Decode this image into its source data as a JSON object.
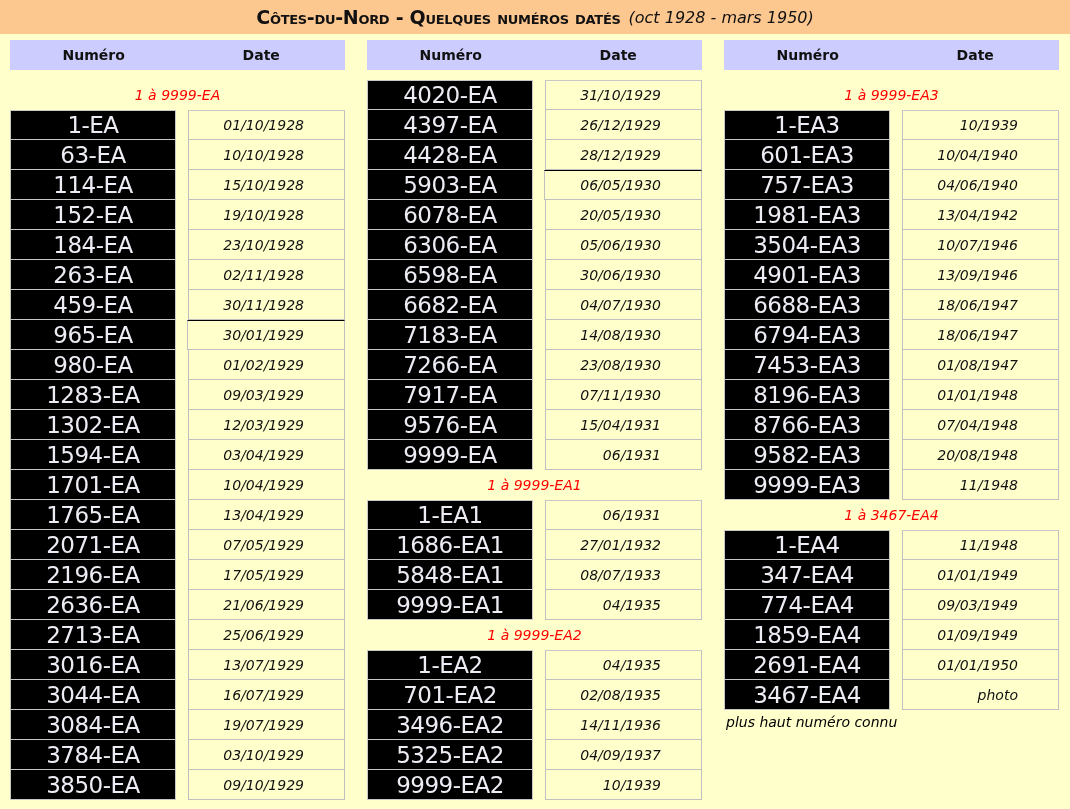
{
  "title": "Côtes-du-Nord - Quelques numéros datés",
  "subtitle": "(oct 1928 - mars 1950)",
  "columns": [
    {
      "headers": [
        "Numéro",
        "Date"
      ],
      "groups": [
        {
          "range_label": "1 à 9999-EA",
          "rows": [
            {
              "number": "1-EA",
              "date": "01/10/1928",
              "separator_above": false
            },
            {
              "number": "63-EA",
              "date": "10/10/1928",
              "separator_above": false
            },
            {
              "number": "114-EA",
              "date": "15/10/1928",
              "separator_above": false
            },
            {
              "number": "152-EA",
              "date": "19/10/1928",
              "separator_above": false
            },
            {
              "number": "184-EA",
              "date": "23/10/1928",
              "separator_above": false
            },
            {
              "number": "263-EA",
              "date": "02/11/1928",
              "separator_above": false
            },
            {
              "number": "459-EA",
              "date": "30/11/1928",
              "separator_above": false
            },
            {
              "number": "965-EA",
              "date": "30/01/1929",
              "separator_above": true
            },
            {
              "number": "980-EA",
              "date": "01/02/1929",
              "separator_above": false
            },
            {
              "number": "1283-EA",
              "date": "09/03/1929",
              "separator_above": false
            },
            {
              "number": "1302-EA",
              "date": "12/03/1929",
              "separator_above": false
            },
            {
              "number": "1594-EA",
              "date": "03/04/1929",
              "separator_above": false
            },
            {
              "number": "1701-EA",
              "date": "10/04/1929",
              "separator_above": false
            },
            {
              "number": "1765-EA",
              "date": "13/04/1929",
              "separator_above": false
            },
            {
              "number": "2071-EA",
              "date": "07/05/1929",
              "separator_above": false
            },
            {
              "number": "2196-EA",
              "date": "17/05/1929",
              "separator_above": false
            },
            {
              "number": "2636-EA",
              "date": "21/06/1929",
              "separator_above": false
            },
            {
              "number": "2713-EA",
              "date": "25/06/1929",
              "separator_above": false
            },
            {
              "number": "3016-EA",
              "date": "13/07/1929",
              "separator_above": false
            },
            {
              "number": "3044-EA",
              "date": "16/07/1929",
              "separator_above": false
            },
            {
              "number": "3084-EA",
              "date": "19/07/1929",
              "separator_above": false
            },
            {
              "number": "3784-EA",
              "date": "03/10/1929",
              "separator_above": false
            },
            {
              "number": "3850-EA",
              "date": "09/10/1929",
              "separator_above": false
            }
          ]
        }
      ]
    },
    {
      "headers": [
        "Numéro",
        "Date"
      ],
      "groups": [
        {
          "rows": [
            {
              "number": "4020-EA",
              "date": "31/10/1929",
              "separator_above": false
            },
            {
              "number": "4397-EA",
              "date": "26/12/1929",
              "separator_above": false
            },
            {
              "number": "4428-EA",
              "date": "28/12/1929",
              "separator_above": false
            },
            {
              "number": "5903-EA",
              "date": "06/05/1930",
              "separator_above": true
            },
            {
              "number": "6078-EA",
              "date": "20/05/1930",
              "separator_above": false
            },
            {
              "number": "6306-EA",
              "date": "05/06/1930",
              "separator_above": false
            },
            {
              "number": "6598-EA",
              "date": "30/06/1930",
              "separator_above": false
            },
            {
              "number": "6682-EA",
              "date": "04/07/1930",
              "separator_above": false
            },
            {
              "number": "7183-EA",
              "date": "14/08/1930",
              "separator_above": false
            },
            {
              "number": "7266-EA",
              "date": "23/08/1930",
              "separator_above": false
            },
            {
              "number": "7917-EA",
              "date": "07/11/1930",
              "separator_above": false
            },
            {
              "number": "9576-EA",
              "date": "15/04/1931",
              "separator_above": false
            },
            {
              "number": "9999-EA",
              "date": "06/1931",
              "separator_above": false
            }
          ]
        },
        {
          "range_label": "1 à 9999-EA1",
          "rows": [
            {
              "number": "1-EA1",
              "date": "06/1931",
              "separator_above": false
            },
            {
              "number": "1686-EA1",
              "date": "27/01/1932",
              "separator_above": false
            },
            {
              "number": "5848-EA1",
              "date": "08/07/1933",
              "separator_above": false
            },
            {
              "number": "9999-EA1",
              "date": "04/1935",
              "separator_above": false
            }
          ]
        },
        {
          "range_label": "1 à 9999-EA2",
          "rows": [
            {
              "number": "1-EA2",
              "date": "04/1935",
              "separator_above": false
            },
            {
              "number": "701-EA2",
              "date": "02/08/1935",
              "separator_above": false
            },
            {
              "number": "3496-EA2",
              "date": "14/11/1936",
              "separator_above": false
            },
            {
              "number": "5325-EA2",
              "date": "04/09/1937",
              "separator_above": false
            },
            {
              "number": "9999-EA2",
              "date": "10/1939",
              "separator_above": false
            }
          ]
        }
      ]
    },
    {
      "headers": [
        "Numéro",
        "Date"
      ],
      "groups": [
        {
          "range_label": "1 à 9999-EA3",
          "rows": [
            {
              "number": "1-EA3",
              "date": "10/1939",
              "separator_above": false
            },
            {
              "number": "601-EA3",
              "date": "10/04/1940",
              "separator_above": false
            },
            {
              "number": "757-EA3",
              "date": "04/06/1940",
              "separator_above": false
            },
            {
              "number": "1981-EA3",
              "date": "13/04/1942",
              "separator_above": false
            },
            {
              "number": "3504-EA3",
              "date": "10/07/1946",
              "separator_above": false
            },
            {
              "number": "4901-EA3",
              "date": "13/09/1946",
              "separator_above": false
            },
            {
              "number": "6688-EA3",
              "date": "18/06/1947",
              "separator_above": false
            },
            {
              "number": "6794-EA3",
              "date": "18/06/1947",
              "separator_above": false
            },
            {
              "number": "7453-EA3",
              "date": "01/08/1947",
              "separator_above": false
            },
            {
              "number": "8196-EA3",
              "date": "01/01/1948",
              "separator_above": false
            },
            {
              "number": "8766-EA3",
              "date": "07/04/1948",
              "separator_above": false
            },
            {
              "number": "9582-EA3",
              "date": "20/08/1948",
              "separator_above": false
            },
            {
              "number": "9999-EA3",
              "date": "11/1948",
              "separator_above": false
            }
          ]
        },
        {
          "range_label": "1 à 3467-EA4",
          "rows": [
            {
              "number": "1-EA4",
              "date": "11/1948",
              "separator_above": false
            },
            {
              "number": "347-EA4",
              "date": "01/01/1949",
              "separator_above": false
            },
            {
              "number": "774-EA4",
              "date": "09/03/1949",
              "separator_above": false
            },
            {
              "number": "1859-EA4",
              "date": "01/09/1949",
              "separator_above": false
            },
            {
              "number": "2691-EA4",
              "date": "01/01/1950",
              "separator_above": false
            },
            {
              "number": "3467-EA4",
              "date": "photo",
              "separator_above": false
            }
          ]
        }
      ],
      "note": "plus haut numéro connu"
    }
  ]
}
